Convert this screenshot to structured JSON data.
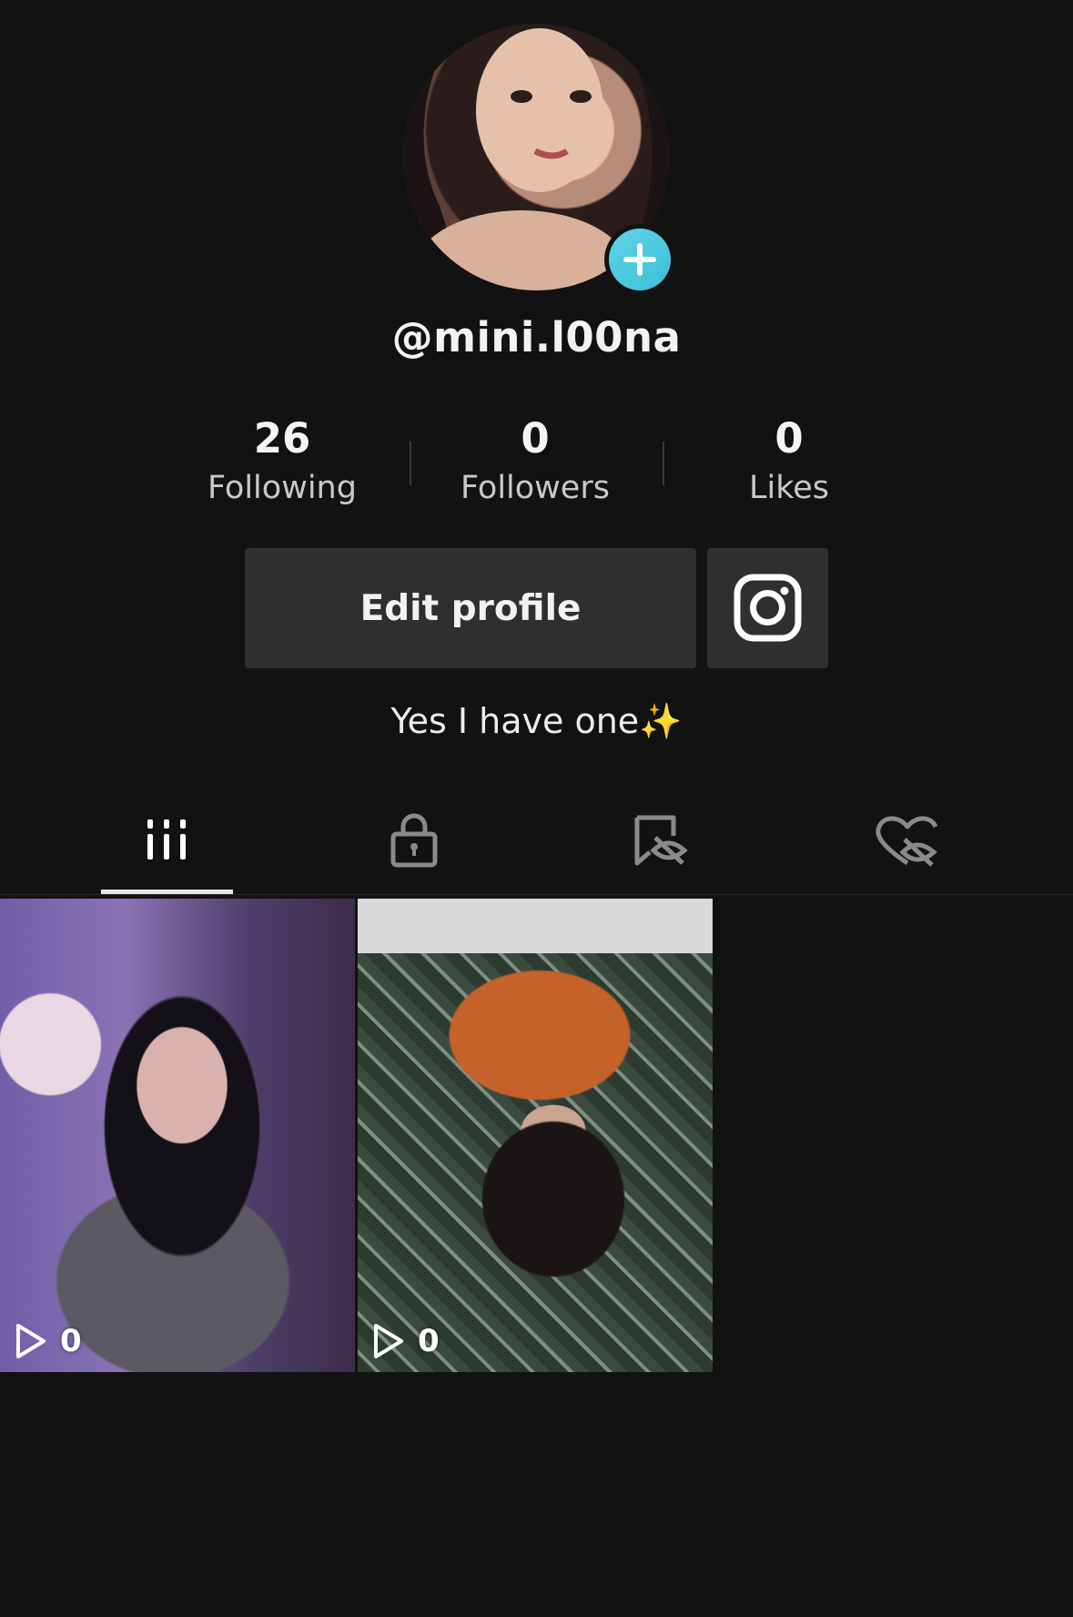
{
  "profile": {
    "username": "@mini.l00na",
    "bio_text": "Yes I have one",
    "bio_emoji": "✨"
  },
  "stats": [
    {
      "value": "26",
      "label": "Following"
    },
    {
      "value": "0",
      "label": "Followers"
    },
    {
      "value": "0",
      "label": "Likes"
    }
  ],
  "actions": {
    "edit_profile": "Edit profile"
  },
  "tabs": [
    {
      "icon": "grid-icon",
      "active": true
    },
    {
      "icon": "lock-icon",
      "active": false
    },
    {
      "icon": "saved-hidden-icon",
      "active": false
    },
    {
      "icon": "liked-hidden-icon",
      "active": false
    }
  ],
  "videos": [
    {
      "views": "0"
    },
    {
      "views": "0"
    }
  ],
  "colors": {
    "background": "#121212",
    "button": "#2f2f2f",
    "add_badge": "#4fcbe0"
  }
}
